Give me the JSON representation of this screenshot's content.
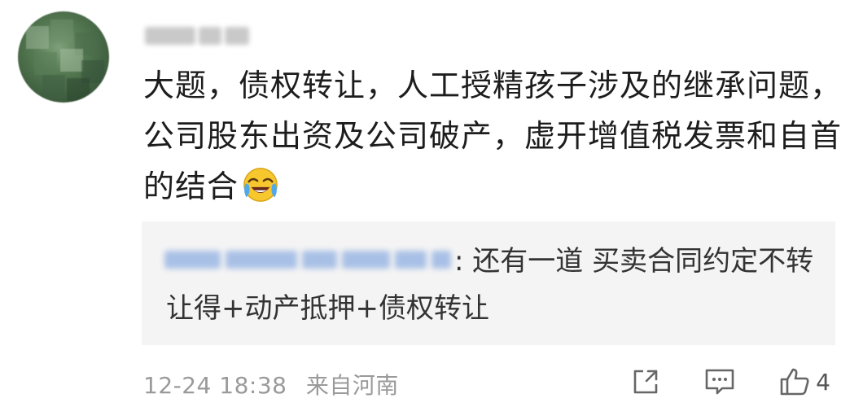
{
  "comment": {
    "username": "",
    "text": "大题，债权转让，人工授精孩子涉及的继承问题，公司股东出资及公司破产，虚开增值税发票和自首的结合",
    "emoji": "laughing-crying-emoji"
  },
  "reply": {
    "username": "",
    "text": ": 还有一道 买卖合同约定不转让得+动产抵押+债权转让"
  },
  "footer": {
    "date": "12-24 18:38",
    "location": "来自河南",
    "like_count": "4"
  },
  "icons": {
    "share": "share-icon",
    "reply": "reply-icon",
    "like": "thumbs-up-icon"
  },
  "colors": {
    "reply_background": "#f4f4f4",
    "meta_gray": "#9a9a9a"
  }
}
